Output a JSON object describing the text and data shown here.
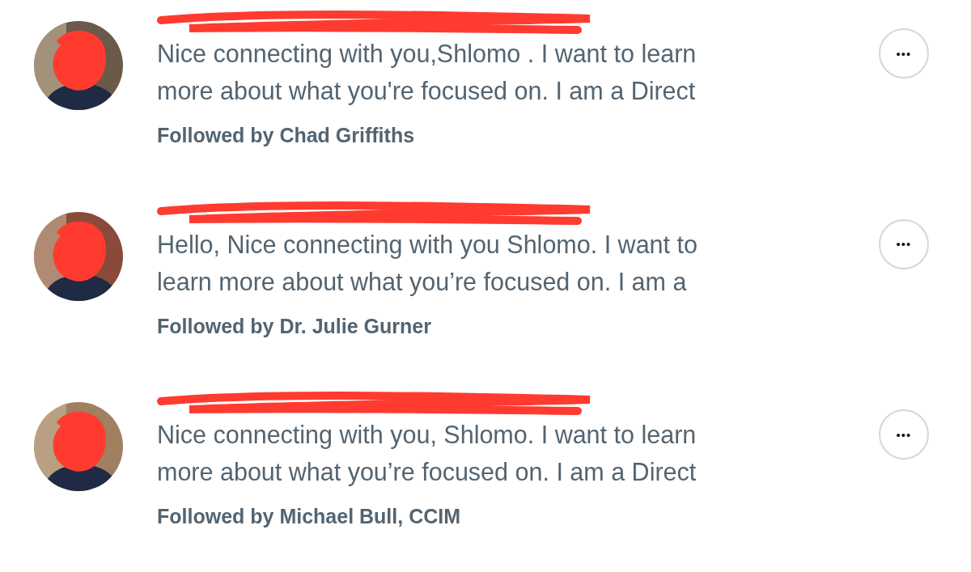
{
  "suggestions": [
    {
      "avatar": {
        "kind": "picture"
      },
      "bio_lines": [
        "Nice connecting with you,Shlomo . I want to learn",
        "more about what you're focused on. I am a Direct"
      ],
      "followed_by": "Followed by Chad Griffiths",
      "more": "•••"
    },
    {
      "avatar": {
        "kind": "picture"
      },
      "bio_lines": [
        "Hello, Nice connecting with you Shlomo. I want to",
        "learn more about what you’re focused on. I am a"
      ],
      "followed_by": "Followed by Dr. Julie Gurner",
      "more": "•••"
    },
    {
      "avatar": {
        "kind": "picture"
      },
      "bio_lines": [
        "Nice connecting with you, Shlomo. I want to learn",
        "more about what you’re focused on. I am a Direct"
      ],
      "followed_by": "Followed by Michael Bull, CCIM",
      "more": "•••"
    }
  ]
}
